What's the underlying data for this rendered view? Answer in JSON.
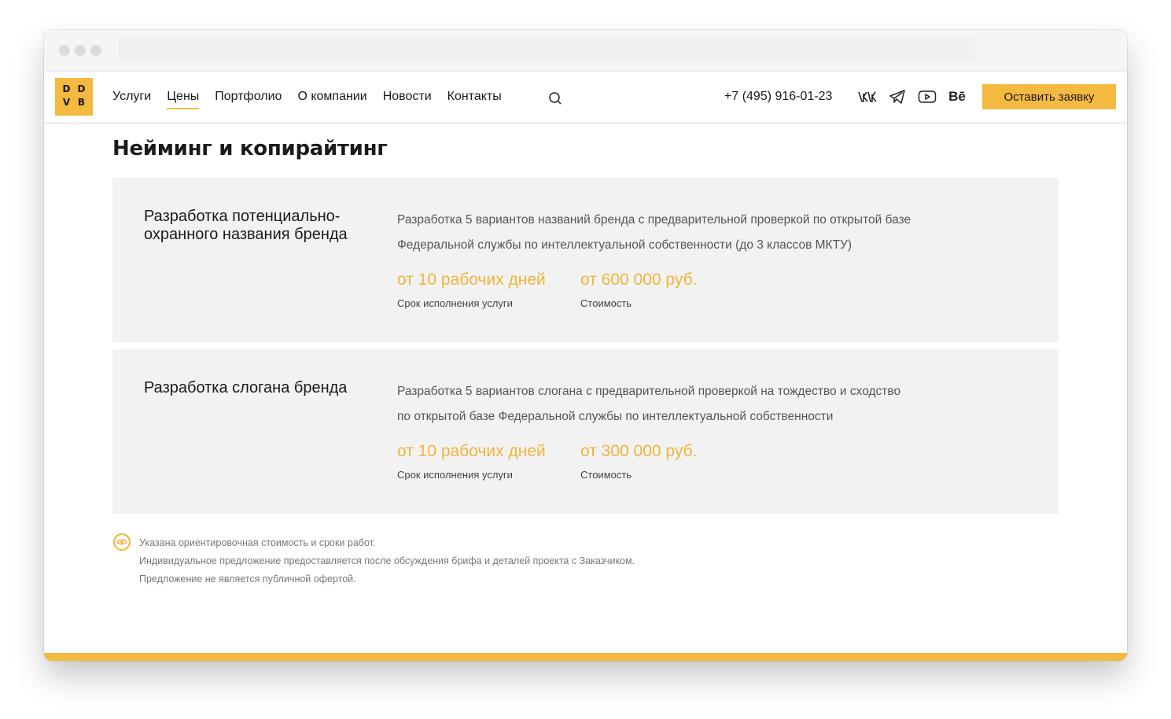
{
  "colors": {
    "accent": "#f4b940",
    "metric": "#f1b43a",
    "card_bg": "#f2f2f2"
  },
  "logo": {
    "letters": [
      "D",
      "D",
      "V",
      "B"
    ]
  },
  "nav": {
    "items": [
      {
        "label": "Услуги"
      },
      {
        "label": "Цены",
        "active": true
      },
      {
        "label": "Портфолио"
      },
      {
        "label": "О компании"
      },
      {
        "label": "Новости"
      },
      {
        "label": "Контакты"
      }
    ]
  },
  "header": {
    "search_icon": "search-icon",
    "phone": "+7 (495) 916-01-23",
    "social": [
      "vk-icon",
      "telegram-icon",
      "youtube-icon",
      "behance-icon"
    ],
    "behance_label": "Bē",
    "cta_label": "Оставить заявку"
  },
  "page": {
    "title": "Нейминг и копирайтинг",
    "services": [
      {
        "name": "Разработка потенциально-охранного названия бренда",
        "description_lines": [
          "Разработка 5 вариантов названий бренда с предварительной проверкой по открытой базе",
          "Федеральной службы по интеллектуальной собственности (до 3 классов МКТУ)"
        ],
        "duration": "от 10 рабочих дней",
        "duration_label": "Срок исполнения услуги",
        "price": "от 600 000 руб.",
        "price_label": "Стоимость"
      },
      {
        "name": "Разработка слогана бренда",
        "description_lines": [
          "Разработка 5 вариантов слогана с предварительной проверкой на тождество и сходство",
          "по открытой базе Федеральной службы по интеллектуальной собственности"
        ],
        "duration": "от 10 рабочих дней",
        "duration_label": "Срок исполнения услуги",
        "price": "от 300 000 руб.",
        "price_label": "Стоимость"
      }
    ],
    "notes": [
      "Указана ориентировочная стоимость и сроки работ.",
      "Индивидуальное предложение предоставляется после обсуждения брифа и деталей проекта с Заказчиком.",
      "Предложение не является публичной офертой."
    ]
  }
}
